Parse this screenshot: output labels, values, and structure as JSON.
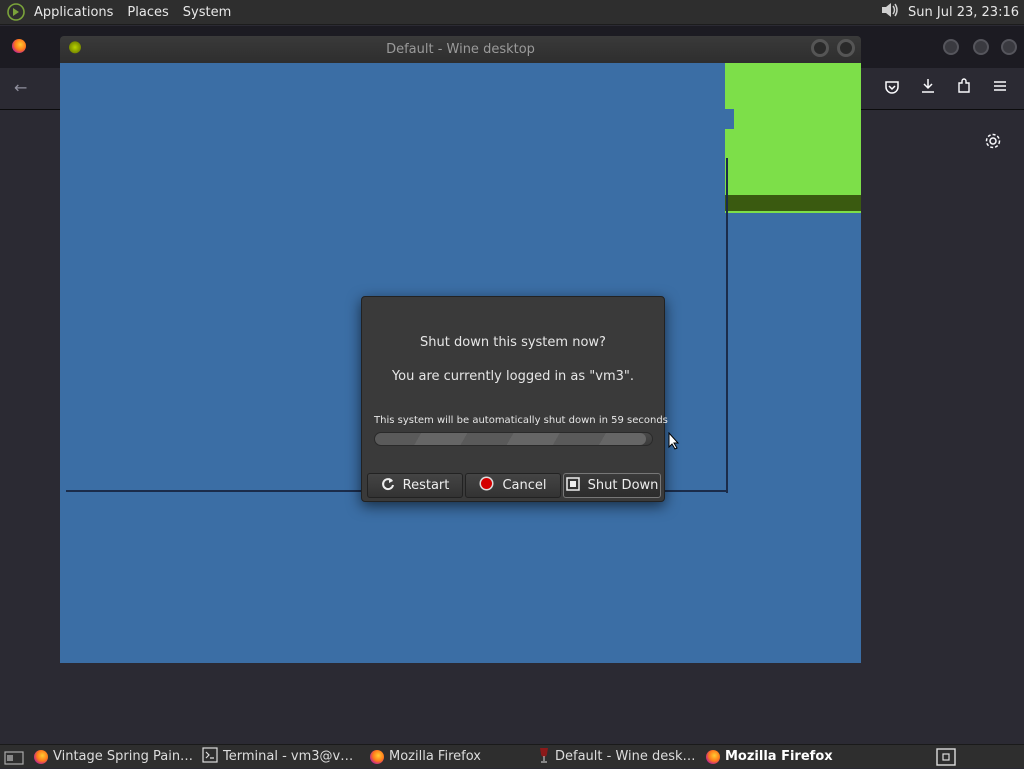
{
  "topbar": {
    "menus": [
      "Applications",
      "Places",
      "System"
    ],
    "clock": "Sun Jul 23, 23:16",
    "icons": [
      "distro-logo-icon",
      "volume-icon"
    ]
  },
  "wine": {
    "window_title": "Default - Wine desktop",
    "desktop_color": "#3b6ea5",
    "shape_color": "#7ddf49"
  },
  "dialog": {
    "question": "Shut down this system now?",
    "logged_in": "You are currently logged in as \"vm3\".",
    "countdown": "This system will be automatically shut down in 59 seconds",
    "progress": 0.98,
    "buttons": {
      "restart": "Restart",
      "cancel": "Cancel",
      "shutdown": "Shut Down"
    }
  },
  "taskbar": {
    "items": [
      "Vintage Spring Pain…",
      "Terminal - vm3@v…",
      "Mozilla Firefox",
      "Default - Wine desk…",
      "Mozilla Firefox"
    ]
  }
}
